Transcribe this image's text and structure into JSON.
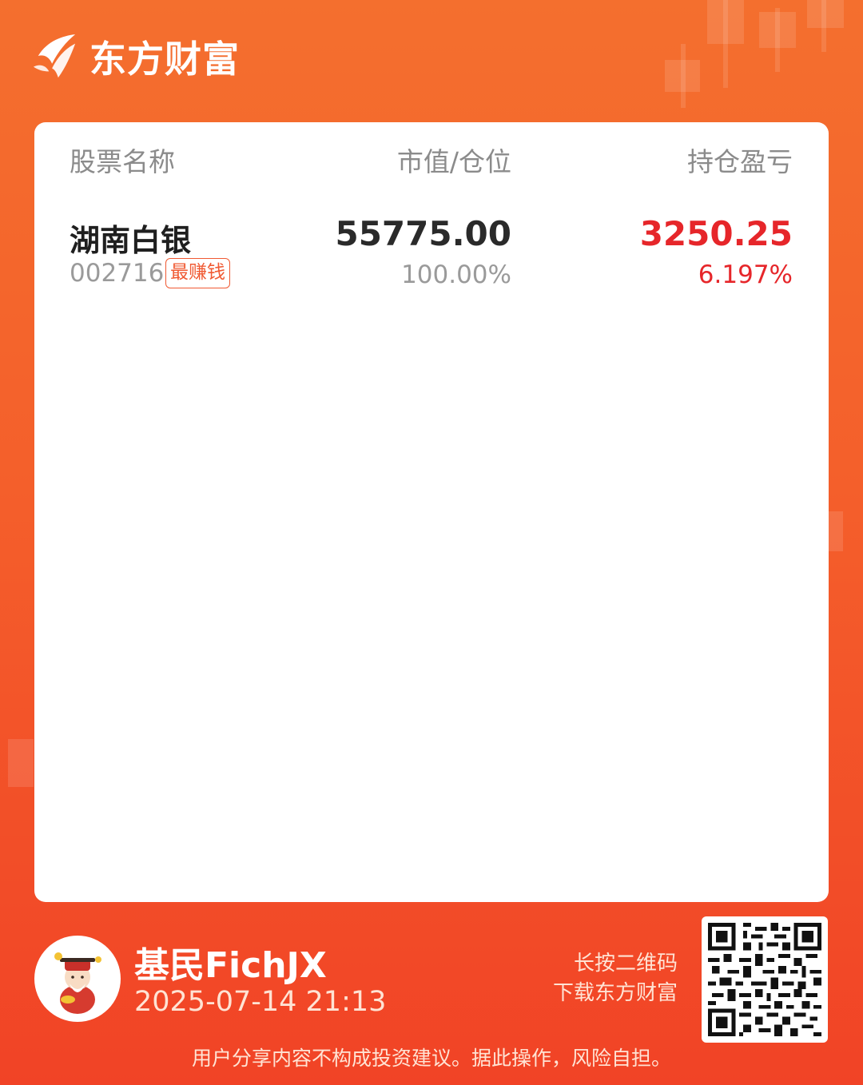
{
  "brand": {
    "name": "东方财富"
  },
  "table": {
    "headers": {
      "name": "股票名称",
      "value": "市值/仓位",
      "pl": "持仓盈亏"
    },
    "rows": [
      {
        "name": "湖南白银",
        "code": "002716",
        "tag": "最赚钱",
        "market_value": "55775.00",
        "position": "100.00%",
        "profit_loss": "3250.25",
        "profit_loss_pct": "6.197%"
      }
    ]
  },
  "user": {
    "name": "基民FichJX",
    "datetime": "2025-07-14 21:13"
  },
  "qr": {
    "hint_line1": "长按二维码",
    "hint_line2": "下载东方财富"
  },
  "disclaimer": "用户分享内容不构成投资建议。据此操作，风险自担。",
  "colors": {
    "accent": "#f45f2b",
    "profit": "#e6262a",
    "tag": "#f05a33"
  }
}
